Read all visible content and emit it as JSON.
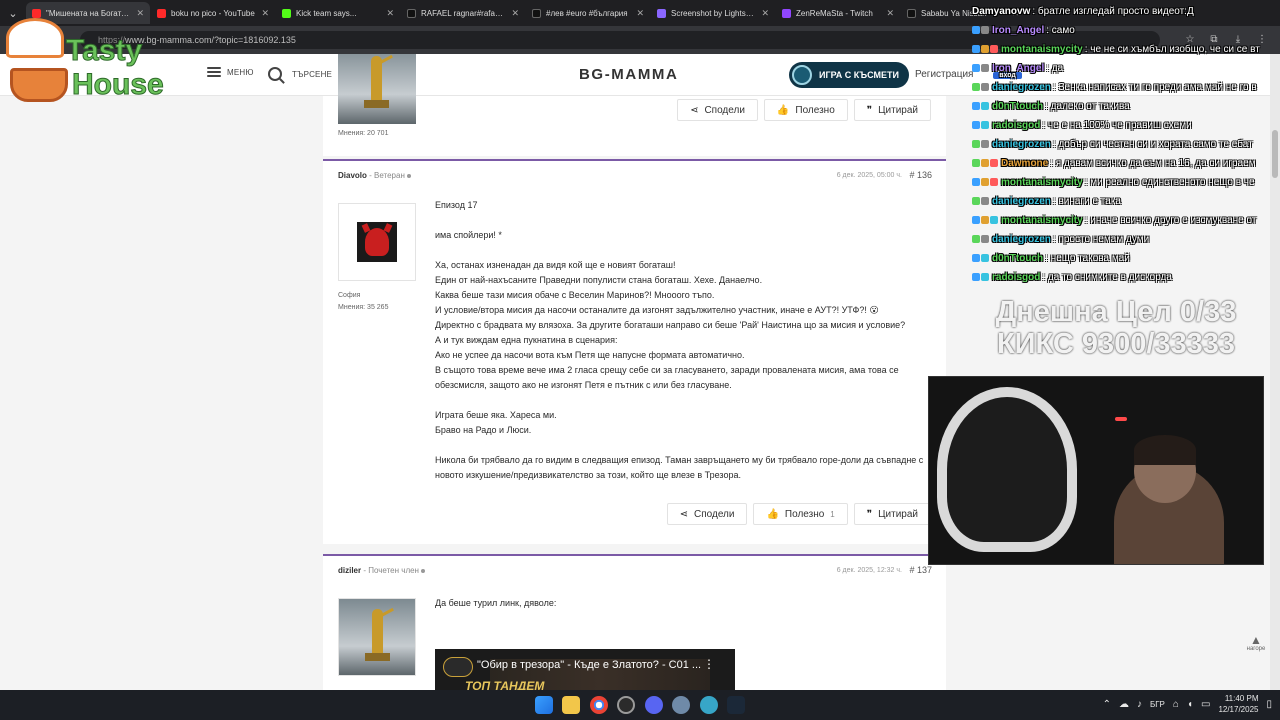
{
  "browser": {
    "tabs": [
      {
        "title": "\"Мишената на Богаташ",
        "color": "#ff2a2a"
      },
      {
        "title": "boku no pico - YouTube",
        "color": "#ff2a2a"
      },
      {
        "title": "Kick team says...",
        "color": "#53fc18"
      },
      {
        "title": "RAFAEL ragnar#rafa#rafi",
        "color": "#111111"
      },
      {
        "title": "#лев #euro #българия",
        "color": "#111111"
      },
      {
        "title": "Screenshot by Lightshot",
        "color": "#8a66ff"
      },
      {
        "title": "ZenReMaSta - Twitch",
        "color": "#9146ff"
      },
      {
        "title": "Sababu Ya Nissan",
        "color": "#111111"
      }
    ],
    "url_prefix": "https://",
    "url": "www.bg-mamma.com/?topic=1816092.135"
  },
  "site": {
    "menu_label": "меню",
    "search_label": "търсене",
    "logo": "BG-MAMMA",
    "game_button": "ИГРА С КЪСМЕТИ",
    "register": "Регистрация"
  },
  "actions": {
    "share": "Сподели",
    "useful": "Полезно",
    "quote": "Цитирай"
  },
  "posts": [
    {
      "author_posts": "Мнения: 20 701"
    },
    {
      "author": "Diavolo",
      "rank": "Ветеран",
      "location": "София",
      "author_posts": "Мнения: 35 265",
      "date": "6 дек. 2025, 05:00 ч.",
      "number": "# 136",
      "useful_count": "1",
      "lines": [
        "Епизод 17",
        "",
        "има спойлери! *",
        "",
        "Ха, останах изненадан да видя кой ще е новият богаташ!",
        "Един от най-нахъсаните Праведни популисти стана богаташ. Хехе. Данаелчо.",
        "Каква беше тази мисия обаче с Веселин Маринов?! Мнооого тъпо.",
        "И условие/втора мисия да насочи останалите да изгонят задължително участник, иначе е АУТ?! УТФ?! 😮",
        "Директно с брадвата му влязоха. За другите богаташи направо си беше 'Рай' Наистина що за мисия и условие?",
        "А и тук виждам една пукнатина в сценария:",
        "Ако не успее да насочи вота към Петя ще напусне формата автоматично.",
        "В същото това време вече има 2 гласа срещу себе си за гласуването, заради провалената мисия, ама това се обезсмисля, защото ако не изгонят Петя е пътник с или без гласуване.",
        "",
        "Играта беше яка. Хареса ми.",
        "Браво на Радо и Люси.",
        "",
        "Никола би трябвало да го видим в следващия епизод. Таман завръщането му би трябвало горе-доли да съвпадне с новото изкушение/предизвикателство за този, който ще влезе в Трезора."
      ]
    },
    {
      "author": "diziler",
      "rank": "Почетен член",
      "date": "6 дек. 2025, 12:32 ч.",
      "number": "# 137",
      "text": "Да беше турил линк, дяволе:",
      "video_title": "\"Обир в трезора\" - Къде е Златото? - С01 ...",
      "video_tag": "ТОП ТАНДЕМ"
    }
  ],
  "overlay": {
    "logo_line1": "Tasty",
    "logo_line2": "House",
    "chat": [
      {
        "name": "Damyanovw",
        "msg": ": братле изгледай просто видеот:Д",
        "color": "#ffffff"
      },
      {
        "name": "Iron_Angel",
        "msg": ": само",
        "color": "#b98cff"
      },
      {
        "name": "montanaismycity",
        "msg": ": че не си хъмбъл изобщо, че си се вт",
        "color": "#5ad65a"
      },
      {
        "name": "Iron_Angel",
        "msg": ": да",
        "color": "#b98cff"
      },
      {
        "name": "daniegrozen",
        "msg": ": Зенка написах ти го преди ама май не го в",
        "color": "#37c3e0"
      },
      {
        "name": "d0nTtouch",
        "msg": ": далеко от такива",
        "color": "#5ad65a"
      },
      {
        "name": "radoisgod",
        "msg": ": че е на 100% че правиш схеми",
        "color": "#5ad65a"
      },
      {
        "name": "daniegrozen",
        "msg": ": добър си честен си и хората само те ебат",
        "color": "#37c3e0"
      },
      {
        "name": "Dawmone",
        "msg": ": я давам всичко да съм на 16, да си играем",
        "color": "#e8a33a"
      },
      {
        "name": "montanaismycity",
        "msg": ": ми реално единственото нещо в че",
        "color": "#5ad65a"
      },
      {
        "name": "daniegrozen",
        "msg": ": винаги е така",
        "color": "#37c3e0"
      },
      {
        "name": "montanaismycity",
        "msg": ": иначе всичко друго е изсмукване от",
        "color": "#5ad65a"
      },
      {
        "name": "daniegrozen",
        "msg": ": просто немам думи",
        "color": "#37c3e0"
      },
      {
        "name": "d0nTtouch",
        "msg": ": нещо такова май",
        "color": "#5ad65a"
      },
      {
        "name": "radoisgod",
        "msg": ": да то снимките в дискорда",
        "color": "#5ad65a"
      }
    ],
    "goal_line1": "Днешна Цел 0/33",
    "goal_line2": "КИКС 9300/33333",
    "login_badge": "вход"
  },
  "page": {
    "to_top": "нагоре"
  },
  "taskbar": {
    "lang": "БГР",
    "time": "11:40 PM",
    "date": "12/17/2025"
  }
}
